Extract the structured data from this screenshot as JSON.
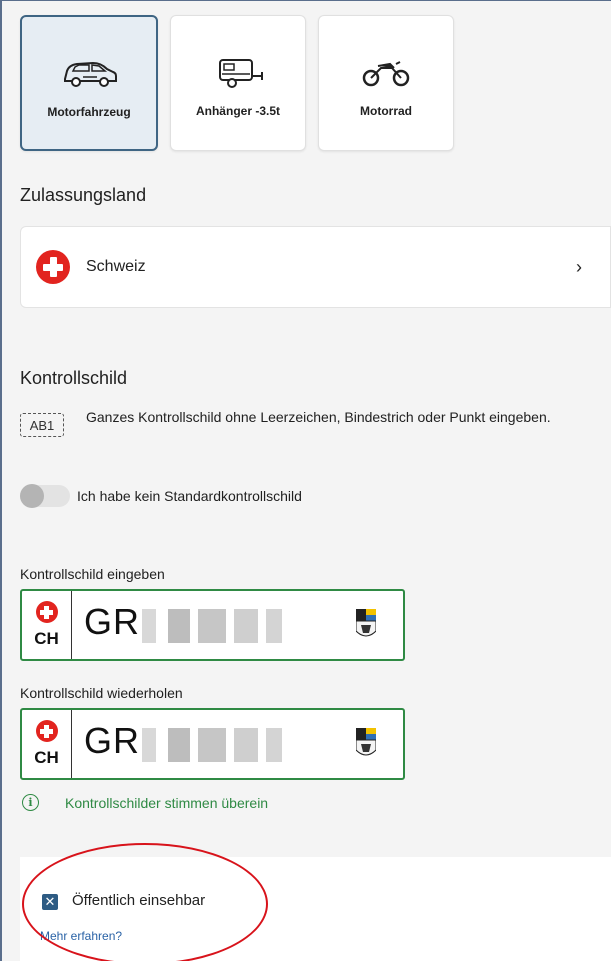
{
  "vehicle_types": [
    {
      "label": "Motorfahrzeug",
      "icon": "car-icon",
      "selected": true
    },
    {
      "label": "Anhänger -3.5t",
      "icon": "trailer-icon",
      "selected": false
    },
    {
      "label": "Motorrad",
      "icon": "motorcycle-icon",
      "selected": false
    }
  ],
  "country": {
    "title": "Zulassungsland",
    "name": "Schweiz",
    "flag_icon": "swiss-flag-icon",
    "chevron": "›"
  },
  "plate_section": {
    "title": "Kontrollschild",
    "hint_icon_text": "AB1",
    "hint": "Ganzes Kontrollschild ohne Leerzeichen, Bindestrich oder Punkt eingeben.",
    "toggle_label": "Ich habe kein Standardkontrollschild",
    "toggle_on": false
  },
  "plate_input": {
    "label": "Kontrollschild eingeben",
    "country_code": "CH",
    "canton_prefix": "GR"
  },
  "plate_repeat": {
    "label": "Kontrollschild wiederholen",
    "country_code": "CH",
    "canton_prefix": "GR"
  },
  "validation": {
    "icon_text": "i",
    "message": "Kontrollschilder stimmen überein"
  },
  "visibility": {
    "checkbox_label": "Öffentlich einsehbar",
    "checked": true,
    "check_mark": "✕",
    "learn_more": "Mehr erfahren?"
  },
  "colors": {
    "accent": "#3f6583",
    "success": "#2f8a44",
    "annotation_red": "#d8131b",
    "swiss_red": "#e2241f",
    "link": "#2962a6"
  }
}
